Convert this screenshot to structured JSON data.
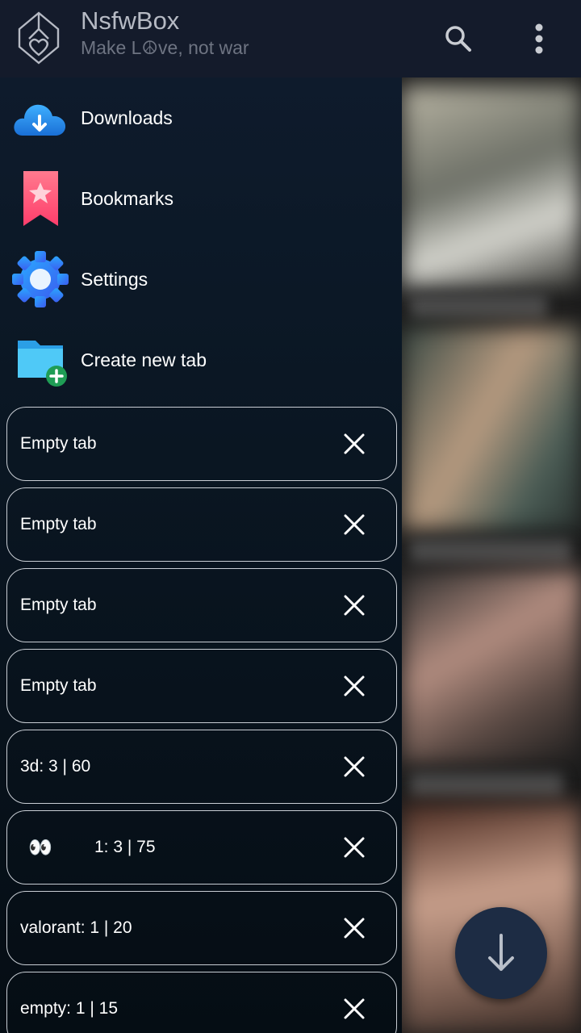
{
  "app": {
    "title": "NsfwBox",
    "subtitle": "Make L☮ve, not war"
  },
  "header": {
    "search_icon": "search-icon",
    "menu_icon": "more-vert-icon"
  },
  "drawer": {
    "items": [
      {
        "label": "Downloads",
        "icon": "cloud-download-icon"
      },
      {
        "label": "Bookmarks",
        "icon": "bookmark-star-icon"
      },
      {
        "label": "Settings",
        "icon": "gear-icon"
      },
      {
        "label": "Create new tab",
        "icon": "folder-add-icon"
      }
    ],
    "tabs": [
      {
        "label": "Empty tab"
      },
      {
        "label": "Empty tab"
      },
      {
        "label": "Empty tab"
      },
      {
        "label": "Empty tab"
      },
      {
        "label": "3d: 3 | 60"
      },
      {
        "prefix": "👀",
        "label": "1: 3 | 75"
      },
      {
        "label": "valorant: 1 | 20"
      },
      {
        "label": "empty: 1 | 15"
      }
    ]
  },
  "fab": {
    "icon": "arrow-down-icon"
  },
  "colors": {
    "appbar": "#141b2b",
    "drawer": "#0a1622",
    "fab": "#1d2c44",
    "tab_border": "#c8cdd4"
  }
}
